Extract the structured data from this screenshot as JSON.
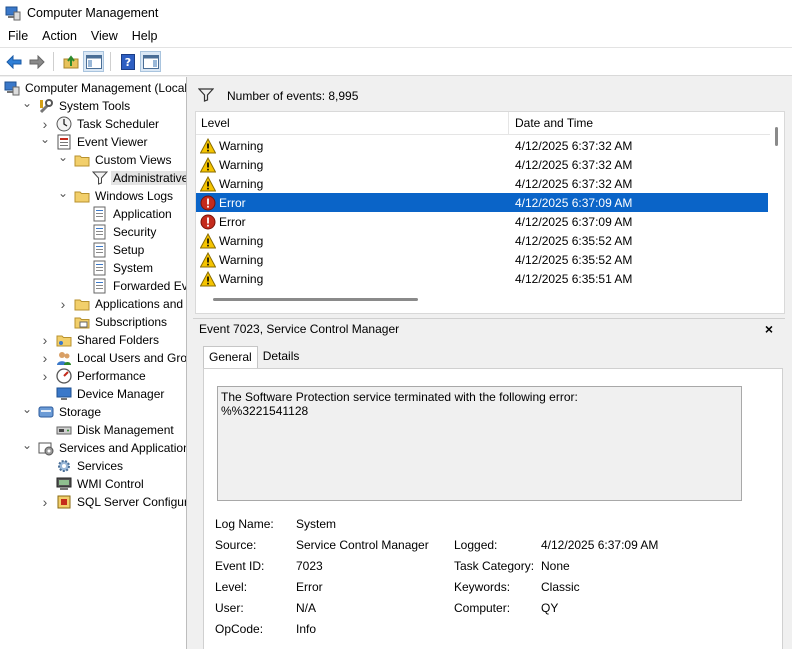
{
  "window": {
    "title": "Computer Management"
  },
  "menu": [
    "File",
    "Action",
    "View",
    "Help"
  ],
  "tree": [
    {
      "label": "Computer Management (Local",
      "depth": 0,
      "chev": "",
      "icon": "computer-management-icon"
    },
    {
      "label": "System Tools",
      "depth": 1,
      "chev": "open",
      "icon": "system-tools-icon"
    },
    {
      "label": "Task Scheduler",
      "depth": 2,
      "chev": "closed",
      "icon": "clock-icon"
    },
    {
      "label": "Event Viewer",
      "depth": 2,
      "chev": "open",
      "icon": "event-viewer-icon"
    },
    {
      "label": "Custom Views",
      "depth": 3,
      "chev": "open",
      "icon": "folder-icon"
    },
    {
      "label": "Administrative E",
      "depth": 4,
      "chev": "",
      "icon": "filter-icon",
      "selected": true
    },
    {
      "label": "Windows Logs",
      "depth": 3,
      "chev": "open",
      "icon": "folder-icon"
    },
    {
      "label": "Application",
      "depth": 4,
      "chev": "",
      "icon": "log-icon"
    },
    {
      "label": "Security",
      "depth": 4,
      "chev": "",
      "icon": "log-icon"
    },
    {
      "label": "Setup",
      "depth": 4,
      "chev": "",
      "icon": "log-icon"
    },
    {
      "label": "System",
      "depth": 4,
      "chev": "",
      "icon": "log-icon"
    },
    {
      "label": "Forwarded Event",
      "depth": 4,
      "chev": "",
      "icon": "log-icon"
    },
    {
      "label": "Applications and Se",
      "depth": 3,
      "chev": "closed",
      "icon": "folder-icon"
    },
    {
      "label": "Subscriptions",
      "depth": 3,
      "chev": "",
      "icon": "subscriptions-icon"
    },
    {
      "label": "Shared Folders",
      "depth": 2,
      "chev": "closed",
      "icon": "shared-folders-icon"
    },
    {
      "label": "Local Users and Groups",
      "depth": 2,
      "chev": "closed",
      "icon": "users-icon"
    },
    {
      "label": "Performance",
      "depth": 2,
      "chev": "closed",
      "icon": "performance-icon"
    },
    {
      "label": "Device Manager",
      "depth": 2,
      "chev": "",
      "icon": "device-manager-icon"
    },
    {
      "label": "Storage",
      "depth": 1,
      "chev": "open",
      "icon": "storage-icon"
    },
    {
      "label": "Disk Management",
      "depth": 2,
      "chev": "",
      "icon": "disk-icon"
    },
    {
      "label": "Services and Applications",
      "depth": 1,
      "chev": "open",
      "icon": "services-apps-icon"
    },
    {
      "label": "Services",
      "depth": 2,
      "chev": "",
      "icon": "gear-icon"
    },
    {
      "label": "WMI Control",
      "depth": 2,
      "chev": "",
      "icon": "wmi-icon"
    },
    {
      "label": "SQL Server Configurati",
      "depth": 2,
      "chev": "closed",
      "icon": "sql-icon"
    }
  ],
  "events": {
    "count_label": "Number of events: 8,995",
    "columns": {
      "level": "Level",
      "date": "Date and Time"
    },
    "rows": [
      {
        "level": "Warning",
        "date": "4/12/2025 6:37:32 AM"
      },
      {
        "level": "Warning",
        "date": "4/12/2025 6:37:32 AM"
      },
      {
        "level": "Warning",
        "date": "4/12/2025 6:37:32 AM"
      },
      {
        "level": "Error",
        "date": "4/12/2025 6:37:09 AM",
        "selected": true
      },
      {
        "level": "Error",
        "date": "4/12/2025 6:37:09 AM"
      },
      {
        "level": "Warning",
        "date": "4/12/2025 6:35:52 AM"
      },
      {
        "level": "Warning",
        "date": "4/12/2025 6:35:52 AM"
      },
      {
        "level": "Warning",
        "date": "4/12/2025 6:35:51 AM"
      }
    ]
  },
  "detail": {
    "title": "Event 7023, Service Control Manager",
    "close": "×",
    "tabs": [
      "General",
      "Details"
    ],
    "description_line1": "The Software Protection service terminated with the following error:",
    "description_line2": "%%3221541128",
    "fields": {
      "log_name_label": "Log Name:",
      "log_name": "System",
      "source_label": "Source:",
      "source": "Service Control Manager",
      "logged_label": "Logged:",
      "logged": "4/12/2025 6:37:09 AM",
      "event_id_label": "Event ID:",
      "event_id": "7023",
      "task_category_label": "Task Category:",
      "task_category": "None",
      "level_label": "Level:",
      "level": "Error",
      "keywords_label": "Keywords:",
      "keywords": "Classic",
      "user_label": "User:",
      "user": "N/A",
      "computer_label": "Computer:",
      "computer": "QY",
      "opcode_label": "OpCode:",
      "opcode": "Info"
    }
  },
  "colors": {
    "selection": "#0a64c8",
    "warning": "#f5c400",
    "error": "#c42b1c"
  }
}
